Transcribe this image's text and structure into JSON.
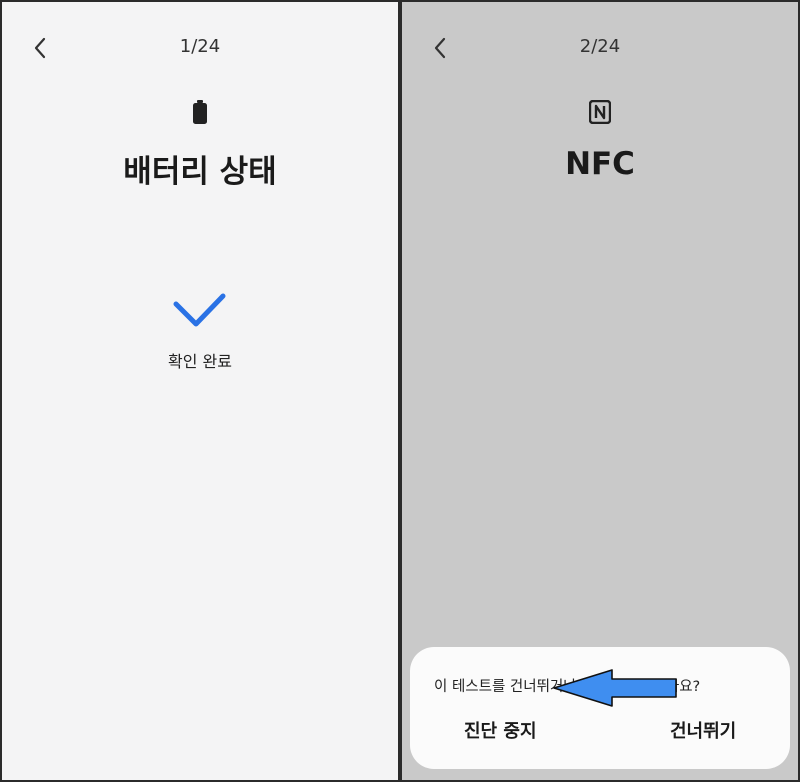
{
  "screens": [
    {
      "step": "1/24",
      "title": "배터리 상태",
      "icon": "battery-icon",
      "result_label": "확인 완료",
      "result_icon": "check-icon",
      "check_color": "#2a72e5"
    },
    {
      "step": "2/24",
      "title": "NFC",
      "icon": "nfc-icon",
      "dialog": {
        "message": "이 테스트를 건너뛰거나 진단을 중지할까요?",
        "stop_label": "진단 중지",
        "skip_label": "건너뛰기"
      },
      "annotation": {
        "icon": "arrow-left-icon",
        "color": "#3f8ef0"
      }
    }
  ]
}
